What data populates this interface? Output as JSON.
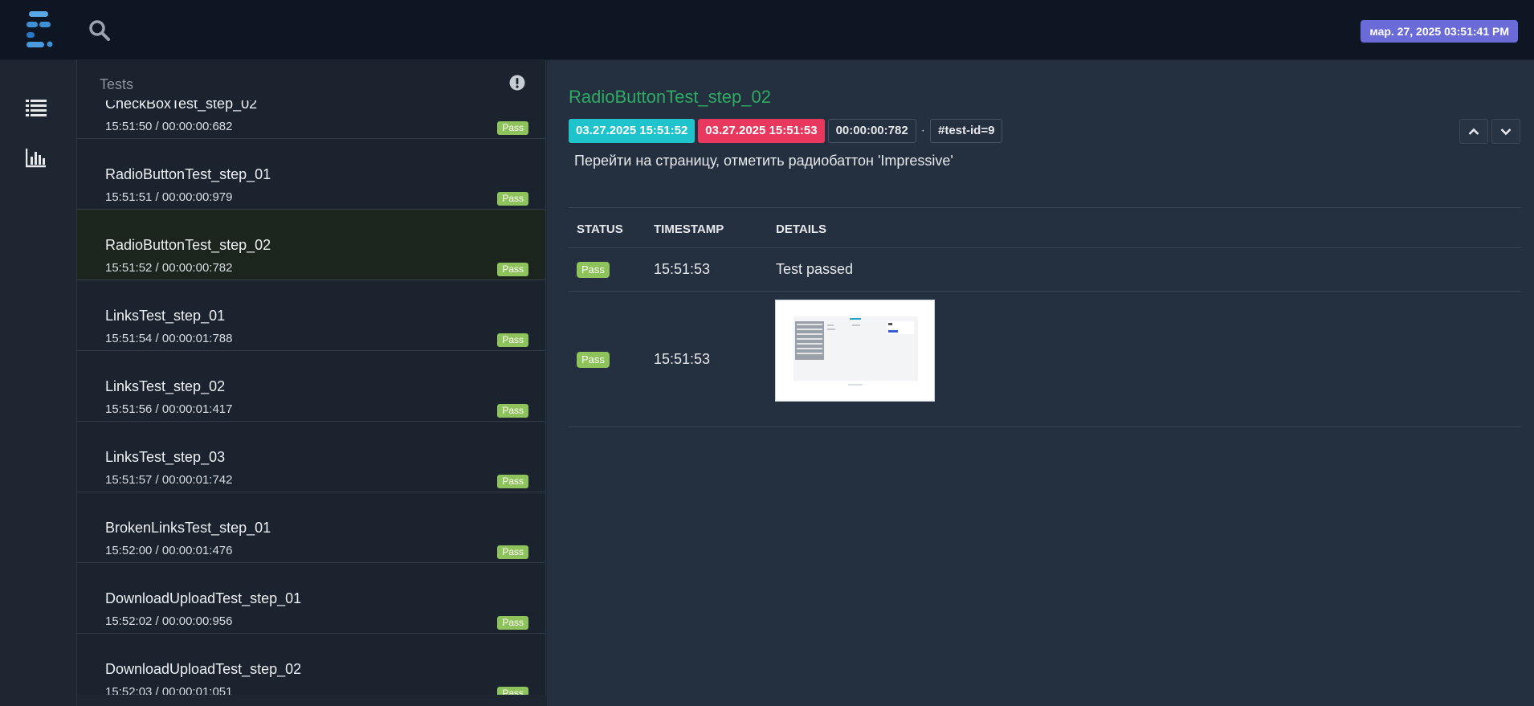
{
  "header": {
    "logo": "extent-logo",
    "search_icon": "search-icon",
    "datetime": "мар. 27, 2025 03:51:41 PM"
  },
  "nav": {
    "items": [
      {
        "icon": "list-icon"
      },
      {
        "icon": "bar-chart-icon"
      }
    ]
  },
  "test_list": {
    "title": "Tests",
    "info_icon": "exclamation-icon",
    "items": [
      {
        "name": "CheckBoxTest_step_02",
        "time": "15:51:50 / 00:00:00:682",
        "status": "Pass"
      },
      {
        "name": "RadioButtonTest_step_01",
        "time": "15:51:51 / 00:00:00:979",
        "status": "Pass"
      },
      {
        "name": "RadioButtonTest_step_02",
        "time": "15:51:52 / 00:00:00:782",
        "status": "Pass"
      },
      {
        "name": "LinksTest_step_01",
        "time": "15:51:54 / 00:00:01:788",
        "status": "Pass"
      },
      {
        "name": "LinksTest_step_02",
        "time": "15:51:56 / 00:00:01:417",
        "status": "Pass"
      },
      {
        "name": "LinksTest_step_03",
        "time": "15:51:57 / 00:00:01:742",
        "status": "Pass"
      },
      {
        "name": "BrokenLinksTest_step_01",
        "time": "15:52:00 / 00:00:01:476",
        "status": "Pass"
      },
      {
        "name": "DownloadUploadTest_step_01",
        "time": "15:52:02 / 00:00:00:956",
        "status": "Pass"
      },
      {
        "name": "DownloadUploadTest_step_02",
        "time": "15:52:03 / 00:00:01:051",
        "status": "Pass"
      }
    ]
  },
  "detail": {
    "title": "RadioButtonTest_step_02",
    "start": "03.27.2025 15:51:52",
    "end": "03.27.2025 15:51:53",
    "duration": "00:00:00:782",
    "separator": "·",
    "test_id": "#test-id=9",
    "description": "Перейти на страницу, отметить радиобаттон 'Impressive'",
    "log": {
      "headers": {
        "status": "STATUS",
        "timestamp": "TIMESTAMP",
        "details": "DETAILS"
      },
      "rows": [
        {
          "status": "Pass",
          "timestamp": "15:51:53",
          "details": "Test passed"
        },
        {
          "status": "Pass",
          "timestamp": "15:51:53",
          "details_image": "screenshot-thumbnail"
        }
      ]
    }
  },
  "colors": {
    "pass": "#8ec25a",
    "start": "#1fc3cc",
    "end": "#e8385d",
    "title": "#2eaa62",
    "datetime_bg": "#6b6bd8"
  }
}
